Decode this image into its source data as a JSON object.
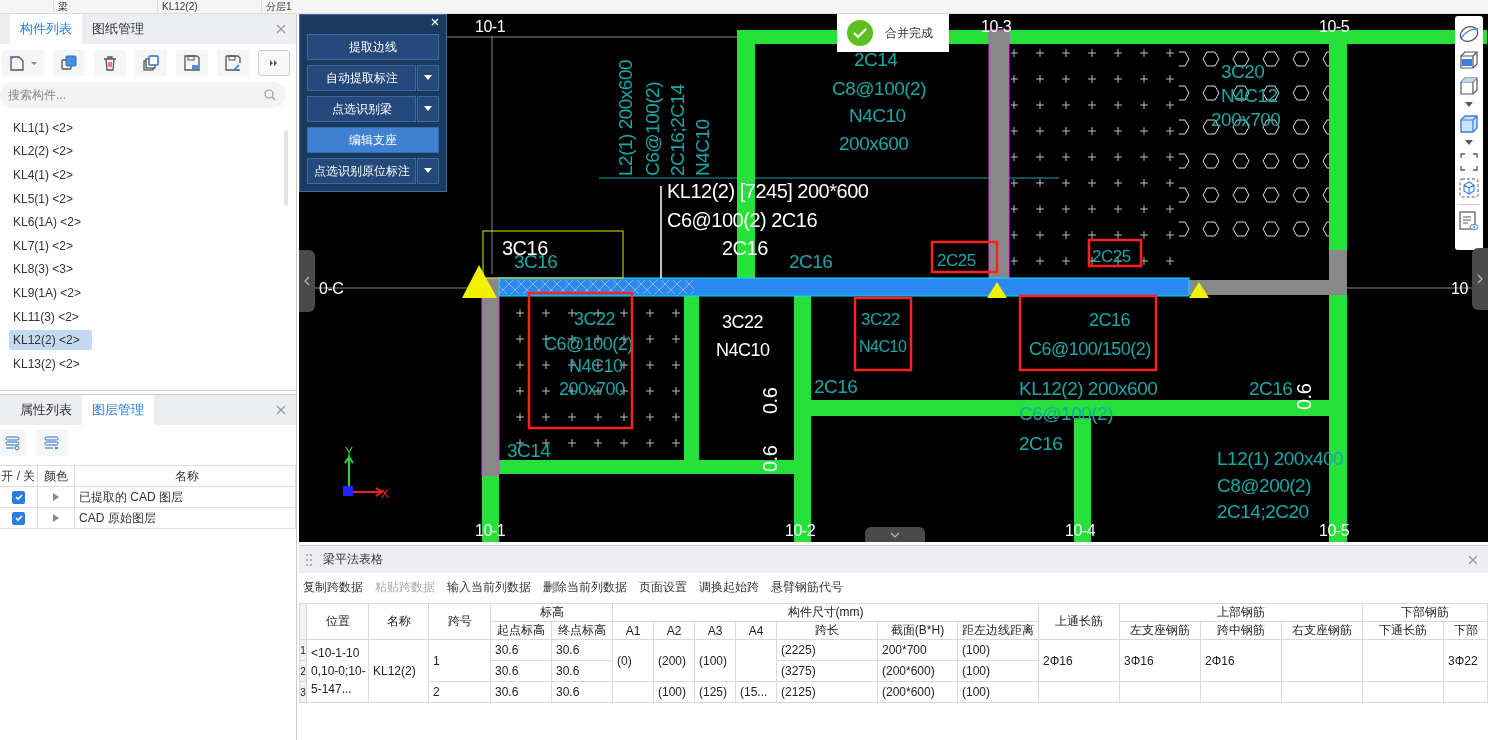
{
  "top_strip": {
    "cells": [
      "梁",
      "KL12(2)",
      "分层1"
    ]
  },
  "component_panel": {
    "tabs": [
      {
        "label": "构件列表",
        "selected": true
      },
      {
        "label": "图纸管理",
        "selected": false
      }
    ],
    "search": {
      "placeholder": "搜索构件..."
    },
    "items": [
      {
        "label": "KL1(1) <2>",
        "selected": false
      },
      {
        "label": "KL2(2) <2>",
        "selected": false
      },
      {
        "label": "KL4(1) <2>",
        "selected": false
      },
      {
        "label": "KL5(1) <2>",
        "selected": false
      },
      {
        "label": "KL6(1A) <2>",
        "selected": false
      },
      {
        "label": "KL7(1) <2>",
        "selected": false
      },
      {
        "label": "KL8(3) <3>",
        "selected": false
      },
      {
        "label": "KL9(1A) <2>",
        "selected": false
      },
      {
        "label": "KL11(3) <2>",
        "selected": false
      },
      {
        "label": "KL12(2) <2>",
        "selected": true
      },
      {
        "label": "KL13(2) <2>",
        "selected": false
      }
    ]
  },
  "layer_panel": {
    "tabs": [
      {
        "label": "属性列表",
        "selected": false
      },
      {
        "label": "图层管理",
        "selected": true
      }
    ],
    "columns": [
      "开 / 关",
      "颜色",
      "名称"
    ],
    "layers": [
      {
        "on": true,
        "expanded": false,
        "name": "已提取的 CAD 图层"
      },
      {
        "on": true,
        "expanded": false,
        "name": "CAD 原始图层"
      }
    ]
  },
  "cad_tools": {
    "buttons": [
      {
        "label": "提取边线",
        "dropdown": false,
        "selected": false
      },
      {
        "label": "自动提取标注",
        "dropdown": true,
        "selected": false
      },
      {
        "label": "点选识别梁",
        "dropdown": true,
        "selected": false
      },
      {
        "label": "编辑支座",
        "dropdown": false,
        "selected": true
      },
      {
        "label": "点选识别原位标注",
        "dropdown": true,
        "selected": false
      }
    ]
  },
  "toast": {
    "message": "合并完成"
  },
  "drawing": {
    "labels": [
      {
        "text": "10-1",
        "kind": "axis"
      },
      {
        "text": "10-3",
        "kind": "axis"
      },
      {
        "text": "10-5",
        "kind": "axis"
      },
      {
        "text": "0-C",
        "kind": "axis"
      },
      {
        "text": "10",
        "kind": "axis"
      },
      {
        "text": "10-1",
        "kind": "axis"
      },
      {
        "text": "10-2",
        "kind": "axis"
      },
      {
        "text": "10-4",
        "kind": "axis"
      },
      {
        "text": "10-5",
        "kind": "axis"
      },
      {
        "text": "KL12(2) [7245] 200*600",
        "kind": "white"
      },
      {
        "text": "C6@100(2) 2C16",
        "kind": "white"
      },
      {
        "text": "3C16",
        "kind": "white"
      },
      {
        "text": "2C16",
        "kind": "white"
      },
      {
        "text": "3C22",
        "kind": "white"
      },
      {
        "text": "N4C10",
        "kind": "white"
      },
      {
        "text": "0.6",
        "kind": "white"
      },
      {
        "text": "0.6",
        "kind": "white"
      },
      {
        "text": "0.6",
        "kind": "white"
      },
      {
        "text": "2C14",
        "kind": "cyan"
      },
      {
        "text": "C8@100(2)",
        "kind": "cyan"
      },
      {
        "text": "N4C10",
        "kind": "cyan"
      },
      {
        "text": "200x600",
        "kind": "cyan"
      },
      {
        "text": "L2(1) 200x600",
        "kind": "cyan"
      },
      {
        "text": "C6@100(2)",
        "kind": "cyan"
      },
      {
        "text": "2C16;2C14",
        "kind": "cyan"
      },
      {
        "text": "N4C10",
        "kind": "cyan"
      },
      {
        "text": "3C20",
        "kind": "cyan"
      },
      {
        "text": "N4C12",
        "kind": "cyan"
      },
      {
        "text": "200x700",
        "kind": "cyan"
      },
      {
        "text": "2C16",
        "kind": "cyan"
      },
      {
        "text": "2C25",
        "kind": "cyan"
      },
      {
        "text": "2C25",
        "kind": "cyan"
      },
      {
        "text": "3C16",
        "kind": "cyan"
      },
      {
        "text": "3C22",
        "kind": "cyan"
      },
      {
        "text": "N4C10",
        "kind": "cyan"
      },
      {
        "text": "2C16",
        "kind": "cyan"
      },
      {
        "text": "C6@100/150(2)",
        "kind": "cyan"
      },
      {
        "text": "3C22",
        "kind": "cyan"
      },
      {
        "text": "C6@100(2)",
        "kind": "cyan"
      },
      {
        "text": "N4C10",
        "kind": "cyan"
      },
      {
        "text": "200x700",
        "kind": "cyan"
      },
      {
        "text": "2C16",
        "kind": "cyan"
      },
      {
        "text": "KL12(2) 200x600",
        "kind": "cyan"
      },
      {
        "text": "C6@100(2)",
        "kind": "cyan"
      },
      {
        "text": "2C16",
        "kind": "cyan"
      },
      {
        "text": "2C16",
        "kind": "cyan"
      },
      {
        "text": "3C14",
        "kind": "cyan"
      },
      {
        "text": "L12(1) 200x400",
        "kind": "cyan"
      },
      {
        "text": "C8@200(2)",
        "kind": "cyan"
      },
      {
        "text": "2C14;2C20",
        "kind": "cyan"
      }
    ],
    "ucs": {
      "x": "X",
      "y": "Y"
    }
  },
  "table_panel": {
    "title": "梁平法表格",
    "actions": [
      {
        "label": "复制跨数据",
        "disabled": false
      },
      {
        "label": "粘贴跨数据",
        "disabled": true
      },
      {
        "label": "输入当前列数据",
        "disabled": false
      },
      {
        "label": "删除当前列数据",
        "disabled": false
      },
      {
        "label": "页面设置",
        "disabled": false
      },
      {
        "label": "调换起始跨",
        "disabled": false
      },
      {
        "label": "悬臂钢筋代号",
        "disabled": false
      }
    ],
    "header": [
      {
        "label": "位置"
      },
      {
        "label": "名称"
      },
      {
        "label": "跨号"
      },
      {
        "label": "标高",
        "children": [
          {
            "label": "起点标高"
          },
          {
            "label": "终点标高"
          }
        ]
      },
      {
        "label": "构件尺寸(mm)",
        "children": [
          {
            "label": "A1"
          },
          {
            "label": "A2"
          },
          {
            "label": "A3"
          },
          {
            "label": "A4"
          },
          {
            "label": "跨长"
          },
          {
            "label": "截面(B*H)"
          },
          {
            "label": "距左边线距离"
          }
        ]
      },
      {
        "label": "上通长筋"
      },
      {
        "label": "上部钢筋",
        "children": [
          {
            "label": "左支座钢筋"
          },
          {
            "label": "跨中钢筋"
          },
          {
            "label": "右支座钢筋"
          }
        ]
      },
      {
        "label": "下部钢筋",
        "children": [
          {
            "label": "下通长筋"
          },
          {
            "label": "下部"
          }
        ]
      }
    ],
    "row_numbers": [
      "1",
      "2",
      "3"
    ],
    "columns": [
      [
        "<10-1-100,10-0;10-5-147..."
      ],
      [
        "KL12(2)"
      ],
      [
        "1",
        "2"
      ],
      [
        "30.6",
        "30.6",
        "30.6"
      ],
      [
        "30.6",
        "30.6",
        "30.6"
      ],
      [
        "(0)",
        null
      ],
      [
        "(200)",
        "(100)"
      ],
      [
        "(100)",
        "(125)"
      ],
      [
        null,
        "(15..."
      ],
      [
        "(2225)",
        "(3275)",
        "(2125)"
      ],
      [
        "200*700",
        "(200*600)",
        "(200*600)"
      ],
      [
        "(100)",
        "(100)",
        "(100)"
      ],
      [
        "2Φ16",
        null
      ],
      [
        "3Φ16",
        null
      ],
      [
        "2Φ16",
        null
      ],
      [
        null,
        null
      ],
      [
        null,
        null
      ],
      [
        "3Φ22",
        null
      ]
    ]
  }
}
